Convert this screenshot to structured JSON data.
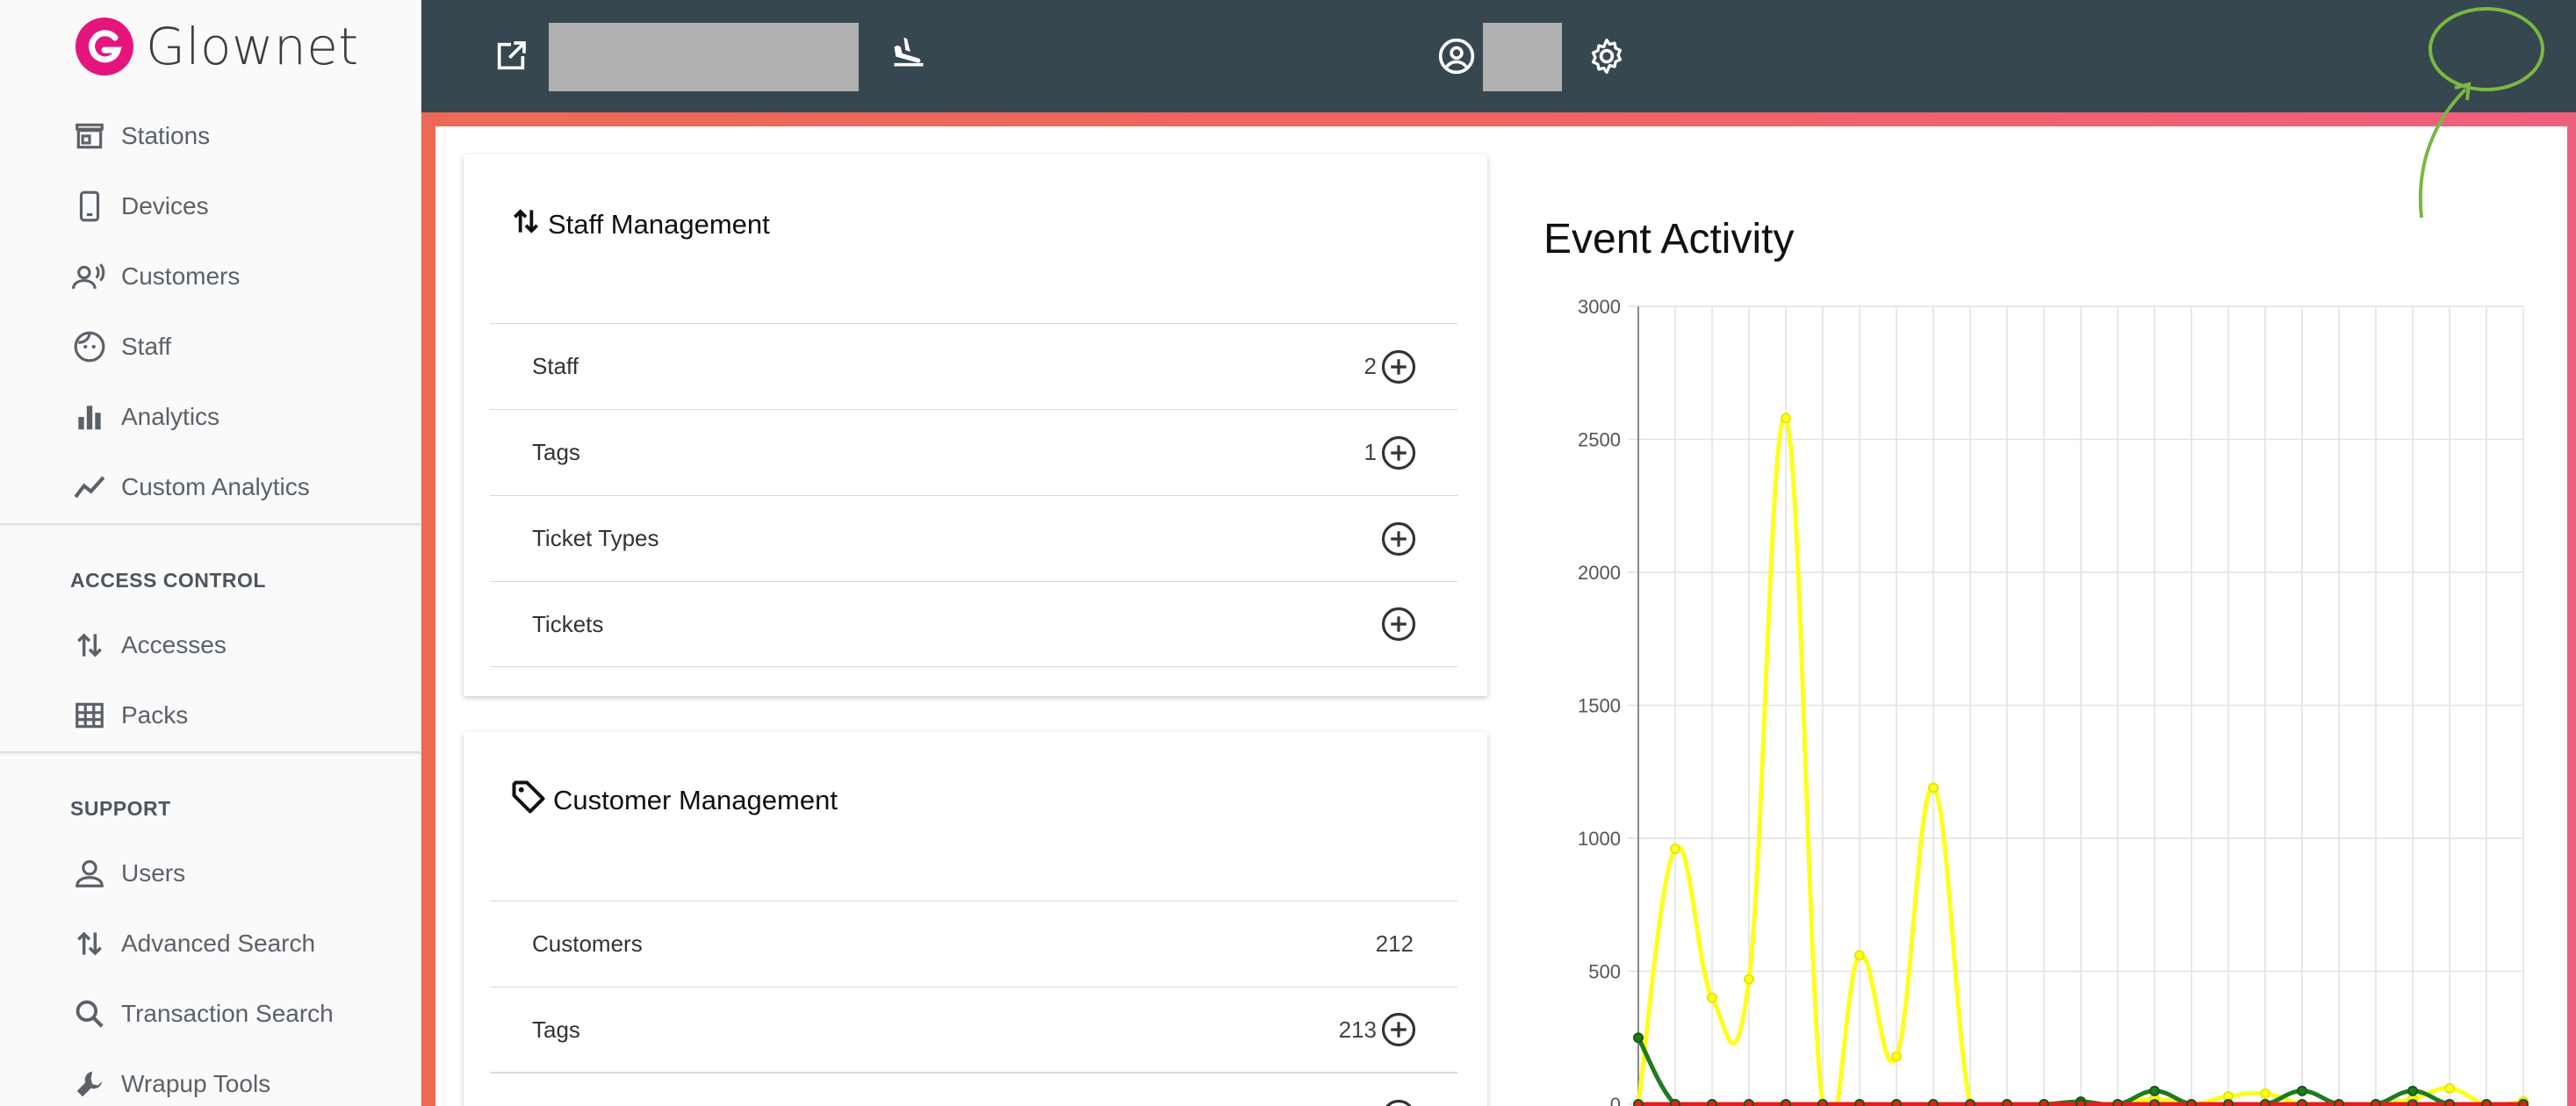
{
  "app": {
    "brand": "Glownet",
    "brand_color": "#e5157d"
  },
  "sidebar": {
    "main_items": [
      {
        "label": "Stations",
        "icon": "store-icon"
      },
      {
        "label": "Devices",
        "icon": "phone-icon"
      },
      {
        "label": "Customers",
        "icon": "customer-voice-icon"
      },
      {
        "label": "Staff",
        "icon": "face-icon"
      },
      {
        "label": "Analytics",
        "icon": "bar-chart-icon"
      },
      {
        "label": "Custom Analytics",
        "icon": "trend-line-icon"
      }
    ],
    "access_title": "ACCESS CONTROL",
    "access_items": [
      {
        "label": "Accesses",
        "icon": "swap-vertical-icon"
      },
      {
        "label": "Packs",
        "icon": "grid-icon"
      }
    ],
    "support_title": "SUPPORT",
    "support_items": [
      {
        "label": "Users",
        "icon": "user-icon"
      },
      {
        "label": "Advanced Search",
        "icon": "swap-vertical-icon"
      },
      {
        "label": "Transaction Search",
        "icon": "search-icon"
      },
      {
        "label": "Wrapup Tools",
        "icon": "wrench-icon"
      }
    ]
  },
  "topbar": {
    "bg_color": "#37474f"
  },
  "staff_card": {
    "title": "Staff Management",
    "rows": [
      {
        "label": "Staff",
        "count": "2",
        "add": true
      },
      {
        "label": "Tags",
        "count": "1",
        "add": true
      },
      {
        "label": "Ticket Types",
        "count": "",
        "add": true
      },
      {
        "label": "Tickets",
        "count": "",
        "add": true
      }
    ]
  },
  "customer_card": {
    "title": "Customer Management",
    "rows": [
      {
        "label": "Customers",
        "count": "212",
        "add": false
      },
      {
        "label": "Tags",
        "count": "213",
        "add": true
      }
    ]
  },
  "chart_data": {
    "type": "line",
    "title": "Event Activity",
    "ylim": [
      0,
      3000
    ],
    "y_ticks": [
      "0",
      "500",
      "1000",
      "1500",
      "2000",
      "2500",
      "3000"
    ],
    "grid": true,
    "x_count": 25,
    "series": [
      {
        "color": "#ffff1a",
        "values": [
          0,
          960,
          400,
          470,
          2580,
          0,
          560,
          180,
          1190,
          0,
          0,
          0,
          0,
          0,
          20,
          0,
          30,
          40,
          0,
          0,
          0,
          20,
          60,
          0,
          10
        ]
      },
      {
        "color": "#1e7b1e",
        "values": [
          250,
          0,
          0,
          0,
          0,
          0,
          0,
          0,
          0,
          0,
          0,
          0,
          10,
          0,
          50,
          0,
          0,
          0,
          50,
          0,
          0,
          50,
          0,
          0,
          0
        ]
      },
      {
        "color": "#e02020",
        "values": [
          0,
          0,
          0,
          0,
          0,
          0,
          0,
          0,
          0,
          0,
          0,
          0,
          0,
          0,
          0,
          0,
          0,
          0,
          0,
          0,
          0,
          0,
          0,
          0,
          0
        ]
      }
    ]
  }
}
